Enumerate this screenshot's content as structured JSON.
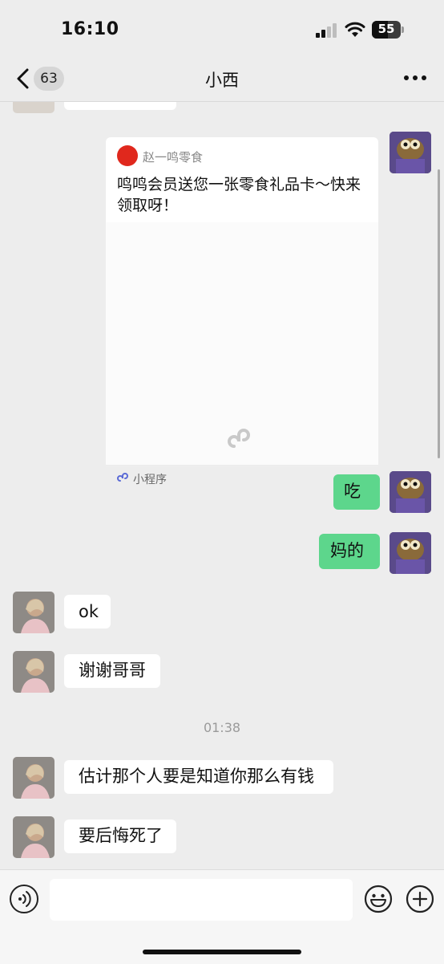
{
  "status": {
    "time": "16:10",
    "battery": "55"
  },
  "nav": {
    "back_count": "63",
    "title": "小西"
  },
  "card": {
    "brand": "赵一鸣零食",
    "description": "鸣鸣会员送您一张零食礼品卡～快来领取呀！",
    "footer_label": "小程序"
  },
  "messages": [
    {
      "from": "me",
      "text": "吃"
    },
    {
      "from": "me",
      "text": "妈的"
    },
    {
      "from": "her",
      "text": "ok"
    },
    {
      "from": "her",
      "text": "谢谢哥哥"
    },
    {
      "from": "her",
      "text": "估计那个人要是知道你那么有钱"
    },
    {
      "from": "her",
      "text": "要后悔死了"
    }
  ],
  "timestamp": "01:38",
  "input": {
    "value": "",
    "placeholder": ""
  },
  "colors": {
    "me_bubble": "#5dd68c",
    "her_bubble": "#ffffff",
    "background": "#ededed"
  },
  "icons": [
    "signal-icon",
    "wifi-icon",
    "battery-icon",
    "back-icon",
    "more-icon",
    "mini-program-icon",
    "voice-icon",
    "emoji-icon",
    "plus-icon"
  ]
}
